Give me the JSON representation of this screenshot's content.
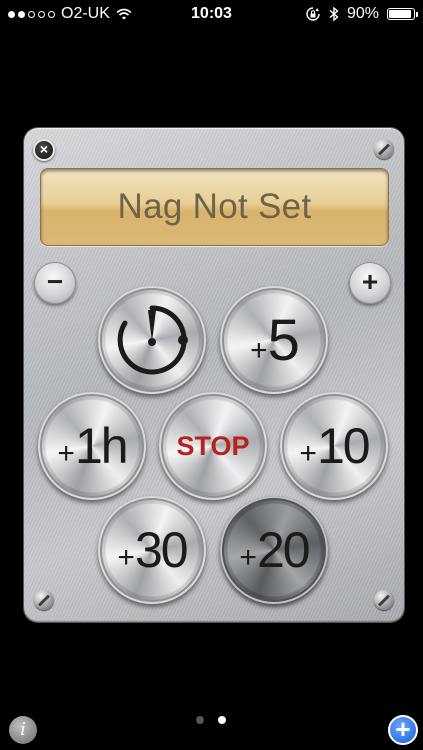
{
  "status_bar": {
    "signal_dots": [
      true,
      true,
      false,
      false,
      false
    ],
    "carrier": "O2-UK",
    "time": "10:03",
    "battery_text": "90%",
    "battery_level": 0.9
  },
  "panel": {
    "display_text": "Nag Not Set",
    "minus_label": "−",
    "plus_label": "+",
    "close_label": "×",
    "buttons": {
      "plus5": {
        "plus": "+",
        "num": "5"
      },
      "plus1h": {
        "plus": "+",
        "num": "1h"
      },
      "stop": {
        "label": "STOP"
      },
      "plus10": {
        "plus": "+",
        "num": "10"
      },
      "plus30": {
        "plus": "+",
        "num": "30"
      },
      "plus20": {
        "plus": "+",
        "num": "20"
      }
    }
  },
  "bottom": {
    "info_label": "i",
    "add_label": "+",
    "pages": 2,
    "active_page": 2
  },
  "colors": {
    "stop_text": "#b6231e",
    "display_bg": "#e7cf98",
    "add_button": "#1b5fd6"
  }
}
